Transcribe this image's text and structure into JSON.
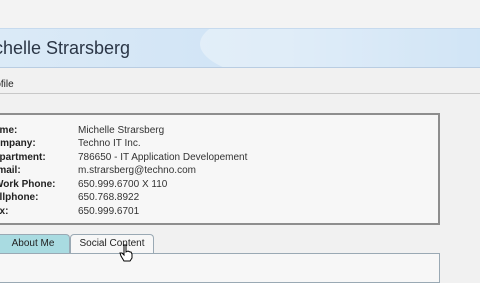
{
  "header": {
    "title": "ichelle Strarsberg"
  },
  "section_label": "rofile",
  "details": [
    {
      "label": "ame:",
      "value": "Michelle Strarsberg"
    },
    {
      "label": "ompany:",
      "value": "Techno IT Inc."
    },
    {
      "label": "epartment:",
      "value": "786650 - IT Application Developement"
    },
    {
      "label": "-mail:",
      "value": "m.strarsberg@techno.com"
    },
    {
      "label": "Work Phone:",
      "value": "650.999.6700 X 110"
    },
    {
      "label": "ellphone:",
      "value": "650.768.8922"
    },
    {
      "label": "ax:",
      "value": "650.999.6701"
    }
  ],
  "tabs": [
    {
      "label": "About Me",
      "active": true
    },
    {
      "label": "Social Content",
      "active": false
    }
  ]
}
